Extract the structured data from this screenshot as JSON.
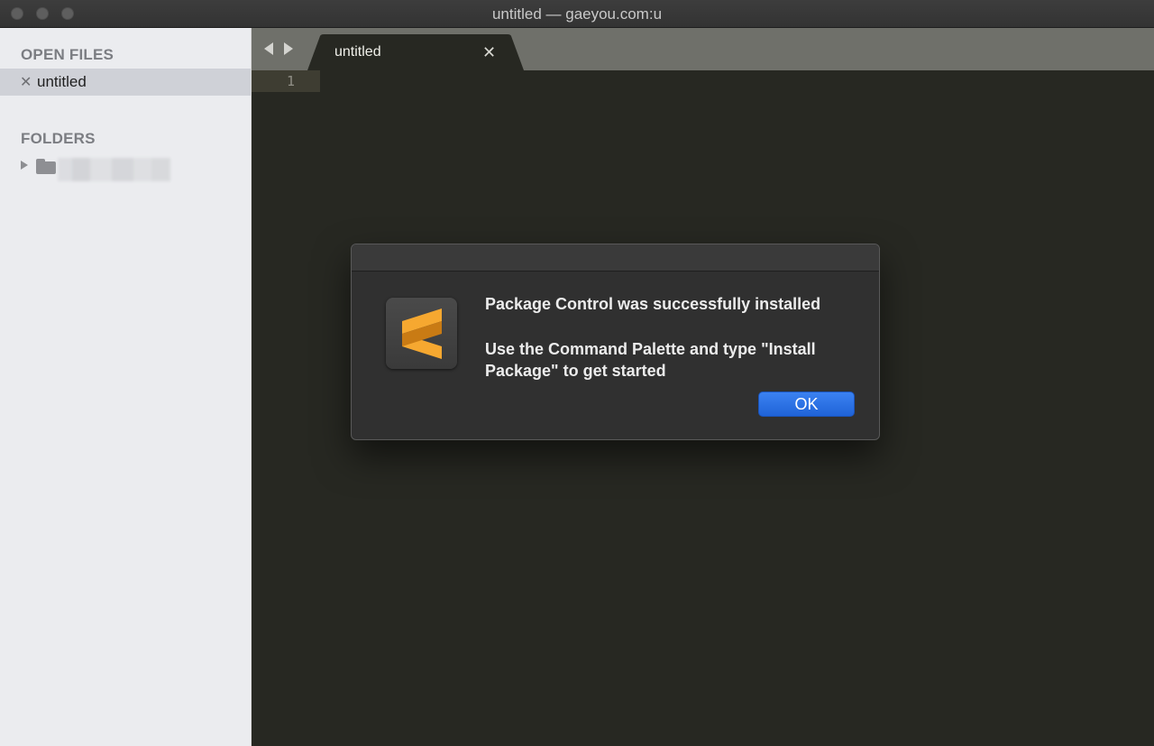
{
  "window": {
    "title": "untitled — gaeyou.com:u",
    "controls": [
      "close-button",
      "minimize-button",
      "zoom-button"
    ]
  },
  "sidebar": {
    "open_files_heading": "OPEN FILES",
    "open_files": [
      {
        "name": "untitled",
        "close_glyph": "✕"
      }
    ],
    "folders_heading": "FOLDERS",
    "folders": [
      {
        "icon": "folder-icon",
        "name_obscured": true
      }
    ]
  },
  "tabs": [
    {
      "label": "untitled",
      "close_glyph": "✕",
      "active": true
    }
  ],
  "editor": {
    "line_numbers": [
      "1"
    ],
    "background": "#272822"
  },
  "dialog": {
    "icon": "sublime-text-icon",
    "title": "Package Control was successfully installed",
    "body": "Use the Command Palette and type \"Install Package\" to get started",
    "ok_label": "OK",
    "accent": "#2a6fe0"
  },
  "colors": {
    "sidebar_bg": "#ebecef",
    "tabbar_bg": "#6f706a",
    "icon_orange": "#f09f2b"
  }
}
